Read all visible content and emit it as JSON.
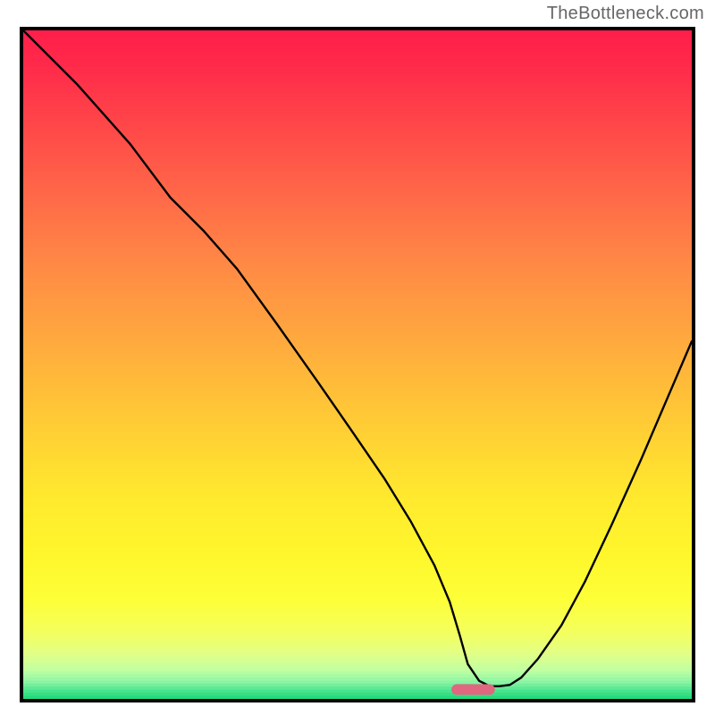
{
  "watermark": "TheBottleneck.com",
  "chart_data": {
    "type": "line",
    "title": "",
    "xlabel": "",
    "ylabel": "",
    "xlim": [
      0,
      100
    ],
    "ylim": [
      0,
      100
    ],
    "grid": false,
    "background": {
      "stops": [
        {
          "pos": 0.0,
          "color": "#ff1f4a"
        },
        {
          "pos": 0.05,
          "color": "#ff2a4a"
        },
        {
          "pos": 0.15,
          "color": "#ff4a49"
        },
        {
          "pos": 0.25,
          "color": "#ff6a48"
        },
        {
          "pos": 0.35,
          "color": "#ff8a45"
        },
        {
          "pos": 0.45,
          "color": "#ffa63f"
        },
        {
          "pos": 0.55,
          "color": "#ffc238"
        },
        {
          "pos": 0.63,
          "color": "#ffd832"
        },
        {
          "pos": 0.7,
          "color": "#ffea2e"
        },
        {
          "pos": 0.78,
          "color": "#fff62c"
        },
        {
          "pos": 0.85,
          "color": "#fdff38"
        },
        {
          "pos": 0.9,
          "color": "#f3ff60"
        },
        {
          "pos": 0.93,
          "color": "#e2ff86"
        },
        {
          "pos": 0.955,
          "color": "#c0ffa2"
        },
        {
          "pos": 0.972,
          "color": "#8ef5a5"
        },
        {
          "pos": 0.985,
          "color": "#4de58f"
        },
        {
          "pos": 1.0,
          "color": "#11d873"
        }
      ]
    },
    "series": [
      {
        "name": "bottleneck-curve",
        "color": "#000000",
        "width": 2.4,
        "x": [
          0.0,
          8.0,
          16.0,
          22.0,
          27.0,
          32.0,
          38.0,
          44.0,
          49.0,
          54.0,
          58.0,
          61.5,
          63.8,
          65.3,
          66.5,
          68.2,
          69.8,
          71.2,
          72.8,
          74.5,
          77.0,
          80.5,
          84.0,
          88.0,
          92.5,
          97.0,
          100.0
        ],
        "y": [
          100.0,
          92.0,
          83.0,
          75.0,
          70.0,
          64.3,
          56.0,
          47.5,
          40.3,
          33.0,
          26.5,
          20.0,
          14.5,
          9.5,
          5.2,
          2.7,
          1.9,
          1.9,
          2.1,
          3.2,
          6.0,
          11.0,
          17.5,
          26.0,
          36.0,
          46.5,
          53.5
        ]
      }
    ],
    "marker": {
      "name": "optimal-range",
      "shape": "pill",
      "color": "#e0677f",
      "x_center": 67.3,
      "y_center": 1.4,
      "width": 6.5,
      "height": 1.6
    }
  }
}
